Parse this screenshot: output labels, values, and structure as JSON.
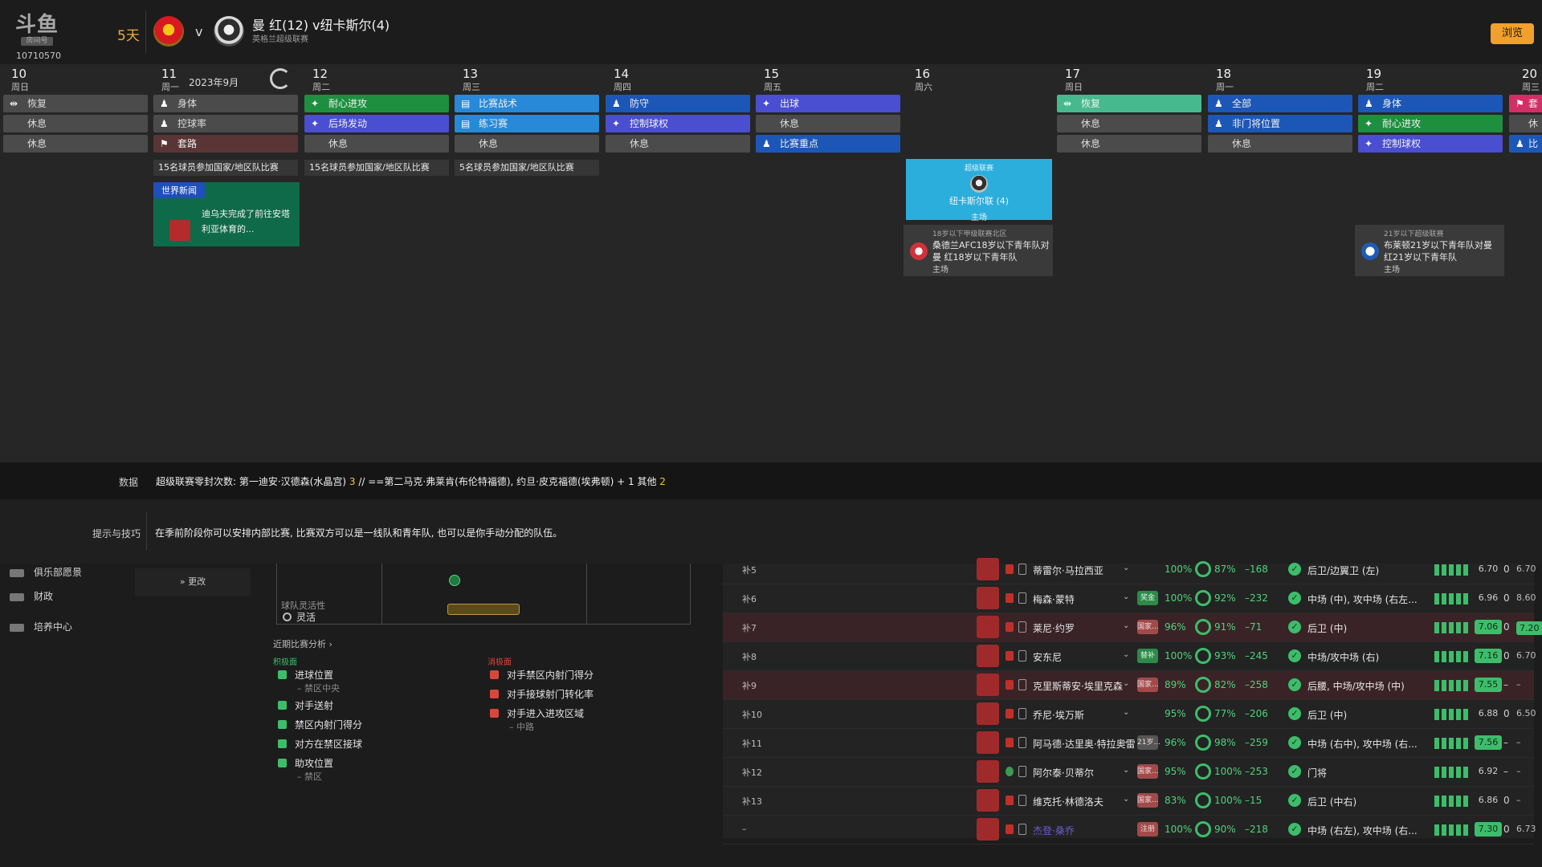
{
  "header": {
    "logo": "斗鱼",
    "logo_sub": "房间号",
    "room_id": "10710570",
    "days_left": "5天",
    "vs": "v",
    "match_title": "曼 红(12) v纽卡斯尔(4)",
    "league": "英格兰超级联赛",
    "browse_label": "浏览"
  },
  "calendar": {
    "month": "2023年9月",
    "days": [
      {
        "num": "10",
        "week": "周日"
      },
      {
        "num": "11",
        "week": "周一"
      },
      {
        "num": "12",
        "week": "周二"
      },
      {
        "num": "13",
        "week": "周三"
      },
      {
        "num": "14",
        "week": "周四"
      },
      {
        "num": "15",
        "week": "周五"
      },
      {
        "num": "16",
        "week": "周六"
      },
      {
        "num": "17",
        "week": "周日"
      },
      {
        "num": "18",
        "week": "周一"
      },
      {
        "num": "19",
        "week": "周二"
      },
      {
        "num": "20",
        "week": "周三"
      }
    ],
    "sessions": {
      "d10": [
        "恢复",
        "休息",
        "休息"
      ],
      "d11": [
        "身体",
        "控球率",
        "套路"
      ],
      "d12": [
        "耐心进攻",
        "后场发动",
        "休息"
      ],
      "d13": [
        "比赛战术",
        "练习赛",
        "休息"
      ],
      "d14": [
        "防守",
        "控制球权",
        "休息"
      ],
      "d15": [
        "出球",
        "休息",
        "比赛重点"
      ],
      "d17": [
        "恢复",
        "休息",
        "休息"
      ],
      "d18": [
        "全部",
        "非门将位置",
        "休息"
      ],
      "d19": [
        "身体",
        "耐心进攻",
        "控制球权"
      ],
      "d20": [
        "套",
        "休",
        "比"
      ]
    },
    "intl": {
      "d11": "15名球员参加国家/地区队比赛",
      "d12": "15名球员参加国家/地区队比赛",
      "d13": "5名球员参加国家/地区队比赛"
    },
    "news": {
      "tag": "世界新闻",
      "text": "迪乌夫完成了前往安塔利亚体育的..."
    },
    "match": {
      "league": "超级联赛",
      "opponent": "纽卡斯尔联 (4)",
      "venue": "主场"
    },
    "youth1": {
      "league": "18岁以下甲级联赛北区",
      "line1": "桑德兰AFC18岁以下青年队对",
      "line2": "曼 红18岁以下青年队",
      "venue": "主场"
    },
    "youth2": {
      "league": "21岁以下超级联赛",
      "line1": "布莱顿21岁以下青年队对曼",
      "line2": "红21岁以下青年队",
      "venue": "主场"
    }
  },
  "data_bar": {
    "label": "数据",
    "text_a": "超级联赛零封次数: 第一迪安·汉德森(水晶宫) ",
    "num_a": "3",
    "text_b": " // ==第二马克·弗莱肯(布伦特福德), 约旦·皮克福德(埃弗顿) + 1 其他 ",
    "num_b": "2"
  },
  "tips": {
    "label": "提示与技巧",
    "text": "在季前阶段你可以安排内部比赛, 比赛双方可以是一线队和青年队, 也可以是你手动分配的队伍。"
  },
  "sidebar": {
    "items": [
      {
        "label": "俱乐部愿景"
      },
      {
        "label": "财政"
      },
      {
        "label": "培养中心"
      }
    ],
    "more": "更改"
  },
  "tactics": {
    "flex_label": "球队灵活性",
    "flex_value": "灵活",
    "analysis_link": "近期比赛分析 ›",
    "positive_head": "积极面",
    "negative_head": "消极面",
    "positives": [
      {
        "label": "进球位置",
        "sub": "– 禁区中央"
      },
      {
        "label": "对手送射",
        "sub": ""
      },
      {
        "label": "禁区内射门得分",
        "sub": ""
      },
      {
        "label": "对方在禁区接球",
        "sub": ""
      },
      {
        "label": "助攻位置",
        "sub": "– 禁区"
      }
    ],
    "negatives": [
      {
        "label": "对手禁区内射门得分",
        "sub": ""
      },
      {
        "label": "对手接球射门转化率",
        "sub": ""
      },
      {
        "label": "对手进入进攻区域",
        "sub": "– 中路"
      }
    ]
  },
  "players": [
    {
      "idx": "补5",
      "name": "蒂雷尔·马拉西亚",
      "badge": "",
      "fit": "100%",
      "cond": "87%",
      "val": "–168",
      "pos": "后卫/边翼卫 (左)",
      "rate": "6.70",
      "goals": "0",
      "avg": "6.70"
    },
    {
      "idx": "补6",
      "name": "梅森·蒙特",
      "badge": "奖金",
      "fit": "100%",
      "cond": "92%",
      "val": "–232",
      "pos": "中场 (中), 攻中场 (右左...",
      "rate": "6.96",
      "goals": "0",
      "avg": "8.60"
    },
    {
      "idx": "补7",
      "name": "莱尼·约罗",
      "badge": "国家...",
      "fit": "96%",
      "cond": "91%",
      "val": "–71",
      "pos": "后卫 (中)",
      "rate": "7.06",
      "goals": "0",
      "avg": "7.20"
    },
    {
      "idx": "补8",
      "name": "安东尼",
      "badge": "替补",
      "fit": "100%",
      "cond": "93%",
      "val": "–245",
      "pos": "中场/攻中场 (右)",
      "rate": "7.16",
      "goals": "0",
      "avg": "6.70"
    },
    {
      "idx": "补9",
      "name": "克里斯蒂安·埃里克森",
      "badge": "国家...",
      "fit": "89%",
      "cond": "82%",
      "val": "–258",
      "pos": "后腰, 中场/攻中场 (中)",
      "rate": "7.55",
      "goals": "–",
      "avg": "–"
    },
    {
      "idx": "补10",
      "name": "乔尼·埃万斯",
      "badge": "",
      "fit": "95%",
      "cond": "77%",
      "val": "–206",
      "pos": "后卫 (中)",
      "rate": "6.88",
      "goals": "0",
      "avg": "6.50"
    },
    {
      "idx": "补11",
      "name": "阿马德·达里奥·特拉奥雷",
      "badge": "21岁...",
      "fit": "96%",
      "cond": "98%",
      "val": "–259",
      "pos": "中场 (右中), 攻中场 (右...",
      "rate": "7.56",
      "goals": "–",
      "avg": "–"
    },
    {
      "idx": "补12",
      "name": "阿尔泰·贝蒂尔",
      "badge": "国家...",
      "fit": "95%",
      "cond": "100%",
      "val": "–253",
      "pos": "门将",
      "rate": "6.92",
      "goals": "–",
      "avg": "–"
    },
    {
      "idx": "补13",
      "name": "维克托·林德洛夫",
      "badge": "国家...",
      "fit": "83%",
      "cond": "100%",
      "val": "–15",
      "pos": "后卫 (中右)",
      "rate": "6.86",
      "goals": "0",
      "avg": "–"
    },
    {
      "idx": "–",
      "name": "杰登·桑乔",
      "badge": "注册",
      "fit": "100%",
      "cond": "90%",
      "val": "–218",
      "pos": "中场 (右左), 攻中场 (右...",
      "rate": "7.30",
      "goals": "0",
      "avg": "6.73"
    }
  ]
}
